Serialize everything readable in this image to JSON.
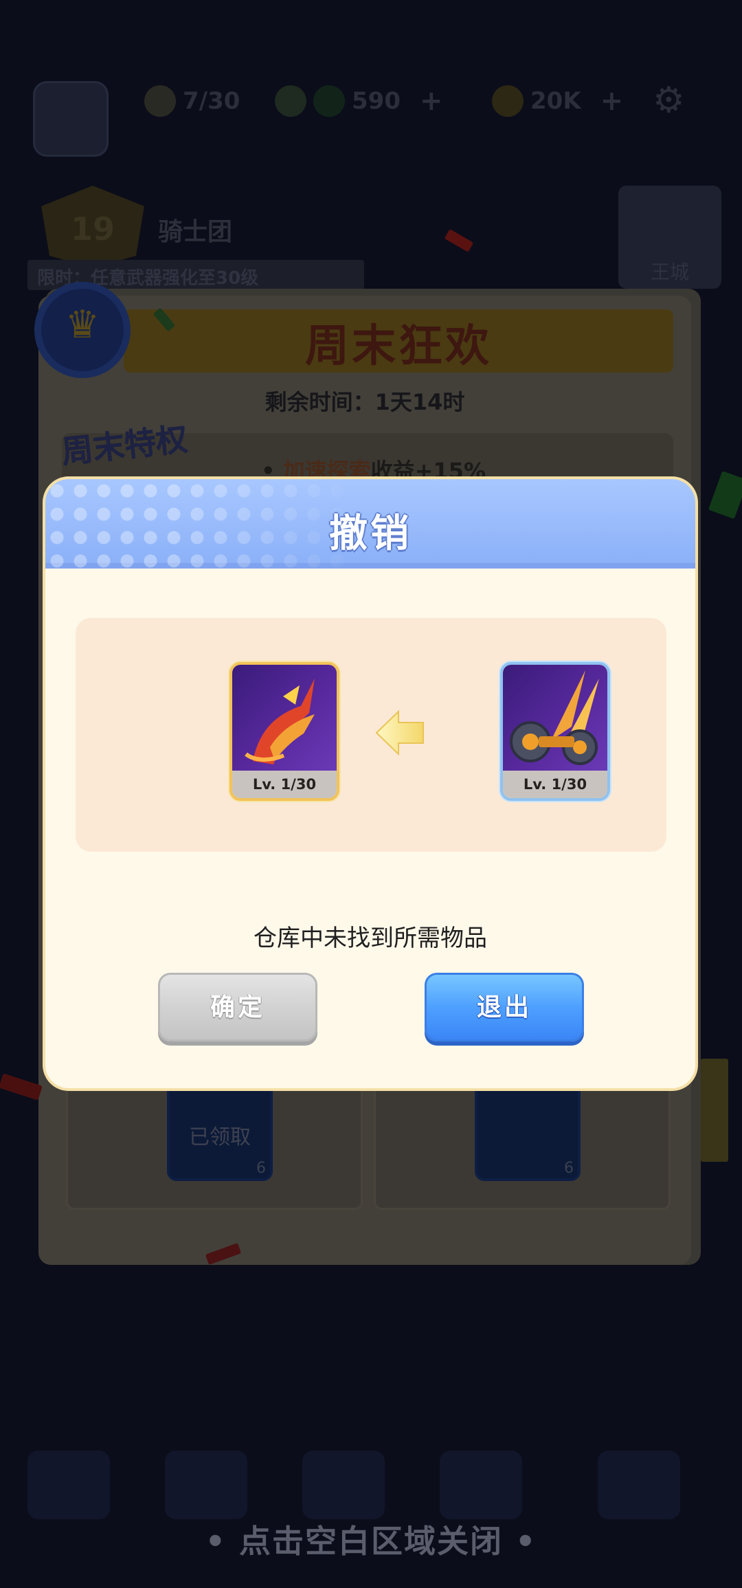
{
  "dialog": {
    "title": "撤销",
    "message": "仓库中未找到所需物品",
    "confirm_label": "确定",
    "exit_label": "退出",
    "left_item": {
      "level": "Lv. 1/30",
      "icon": "dragon-bow-icon"
    },
    "right_item": {
      "level": "Lv. 1/30",
      "icon": "shield-axe-icon"
    },
    "arrow_icon": "arrow-left-icon"
  },
  "background": {
    "energy": "7/30",
    "gems": "590",
    "coins": "20K",
    "guild_level": "19",
    "guild_name": "骑士团",
    "guild_bar_text": "限时：任意武器强化至30级",
    "king_label": "王城",
    "event_title": "周末狂欢",
    "remaining_time": "剩余时间：1天14时",
    "perk_badge": "周末特权",
    "perk_bullet": "•",
    "perk_highlight": "加速探索",
    "perk_text": "收益+15%",
    "claimed_label": "已领取",
    "reward_count_1": "6",
    "reward_count_2": "6"
  },
  "footer": {
    "close_hint": "• 点击空白区域关闭 •"
  },
  "colors": {
    "header_blue": "#9bbcfc",
    "dialog_bg": "#fff9ea",
    "panel_bg": "#fbe9d6",
    "exit_blue": "#4ea0ff",
    "confirm_gray": "#d2d2d2",
    "rarity_gold": "#f2c35a",
    "rarity_blue": "#8fc2f0"
  }
}
